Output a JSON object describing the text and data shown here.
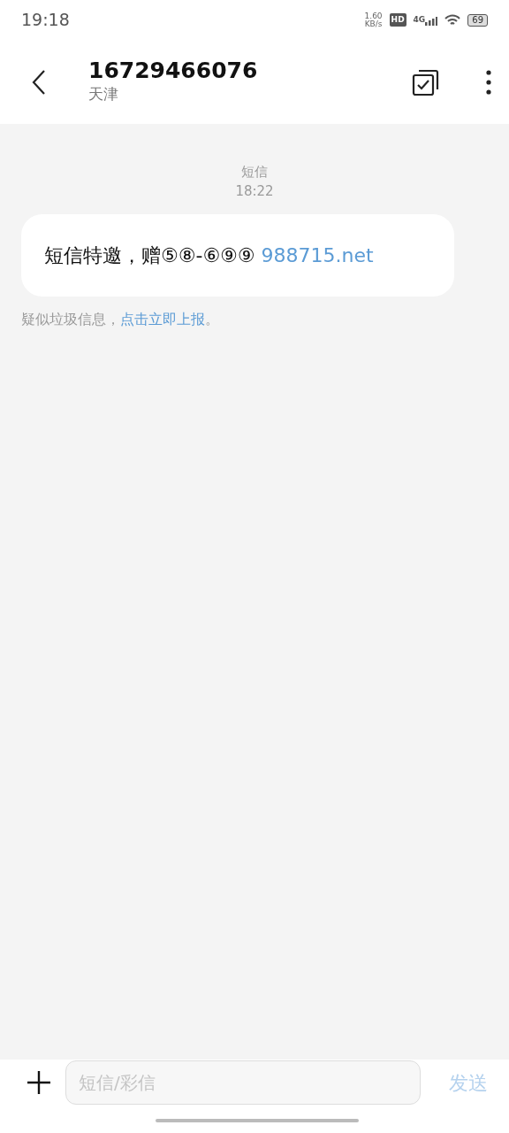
{
  "status_bar": {
    "time": "19:18",
    "net_speed": "1.60",
    "net_unit": "KB/s",
    "hd_badge": "HD",
    "network": "4G",
    "battery": "69"
  },
  "header": {
    "title": "16729466076",
    "subtitle": "天津"
  },
  "messages": [
    {
      "channel": "短信",
      "time": "18:22",
      "text": "短信特邀，赠⑤⑧-⑥⑨⑨ ",
      "link": "988715.net"
    }
  ],
  "spam_notice": {
    "text_before": "疑似垃圾信息，",
    "link": "点击立即上报",
    "text_after": "。"
  },
  "composer": {
    "placeholder": "短信/彩信",
    "send_label": "发送",
    "send_disabled": true
  }
}
